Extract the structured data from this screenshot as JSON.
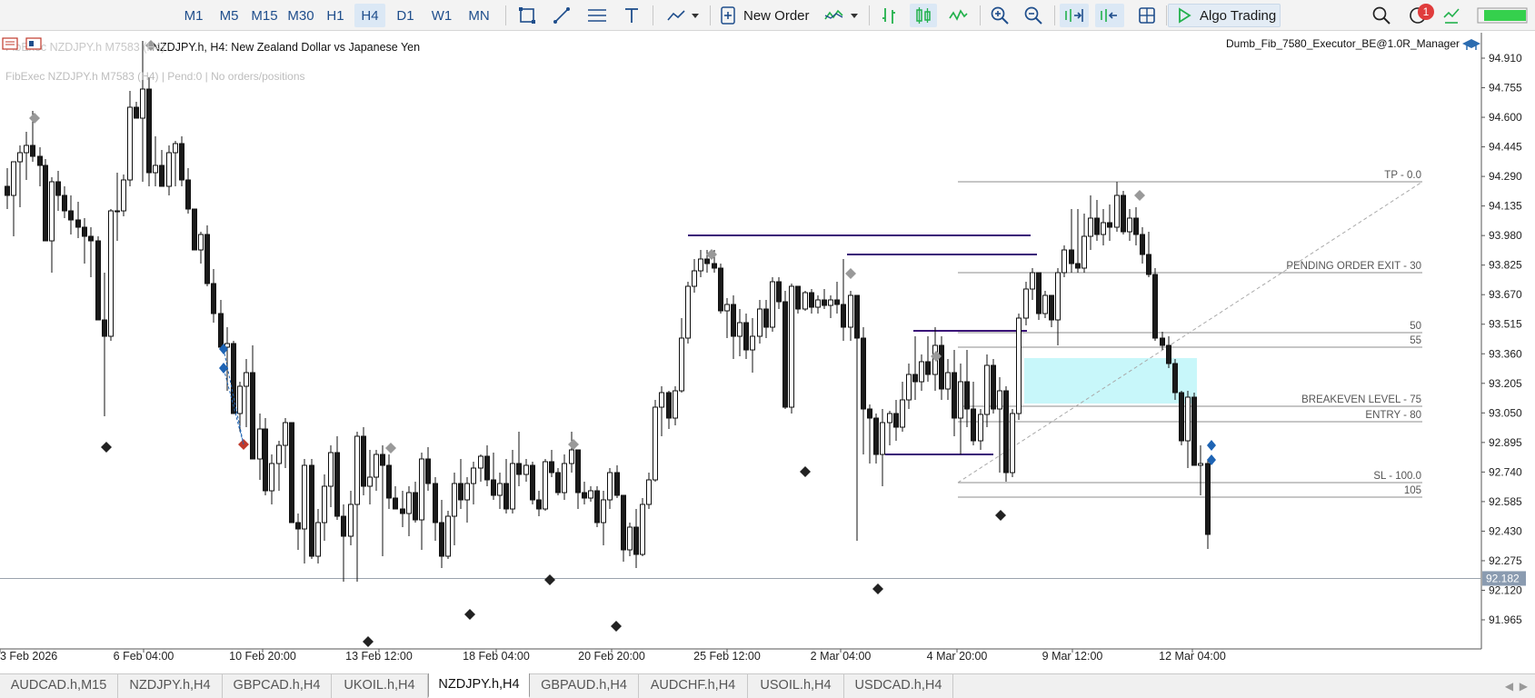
{
  "toolbar": {
    "timeframes": [
      "M1",
      "M5",
      "M15",
      "M30",
      "H1",
      "H4",
      "D1",
      "W1",
      "MN"
    ],
    "active_timeframe": "H4",
    "new_order_label": "New Order",
    "algo_trading_label": "Algo Trading",
    "notification_count": "1",
    "accent_color": "#1f4e8c",
    "signal_color": "#22b14c"
  },
  "chart": {
    "symbol_title": "NZDJPY.h, H4:  New Zealand Dollar vs Japanese Yen",
    "overlay_ghost_text": "FibExec NZDJPY.h M7583 (H4)",
    "status_text": "FibExec NZDJPY.h M7583 (H4) | Pend:0 | No orders/positions",
    "expert_name": "Dumb_Fib_7580_Executor_BE@1.0R_Manager",
    "current_price": "92.182",
    "price_labels": [
      "94.910",
      "94.755",
      "94.600",
      "94.445",
      "94.290",
      "94.135",
      "93.980",
      "93.825",
      "93.670",
      "93.515",
      "93.360",
      "93.205",
      "93.050",
      "92.895",
      "92.740",
      "92.585",
      "92.430",
      "92.275",
      "92.120",
      "91.965"
    ],
    "time_labels": [
      "3 Feb 2026",
      "6 Feb 04:00",
      "10 Feb 20:00",
      "13 Feb 12:00",
      "18 Feb 04:00",
      "20 Feb 20:00",
      "25 Feb 12:00",
      "2 Mar 04:00",
      "4 Mar 20:00",
      "9 Mar 12:00",
      "12 Mar 04:00"
    ],
    "fib_labels": [
      "TP - 0.0",
      "PENDING ORDER EXIT - 30",
      "50",
      "55",
      "BREAKEVEN LEVEL - 75",
      "ENTRY - 80",
      "SL - 100.0",
      "105"
    ],
    "colors": {
      "fib_line": "#8c8c8c",
      "swing_line": "#3a1078",
      "zone": "#c8f7fa",
      "bullish_body": "#ffffff",
      "bearish_body": "#1a1a1a",
      "price_tag": "#8a9bb0"
    }
  },
  "tabs": [
    "AUDCAD.h,M15",
    "NZDJPY.h,H4",
    "GBPCAD.h,H4",
    "UKOIL.h,H4",
    "NZDJPY.h,H4",
    "GBPAUD.h,H4",
    "AUDCHF.h,H4",
    "USOIL.h,H4",
    "USDCAD.h,H4"
  ],
  "active_tab_index": 4
}
